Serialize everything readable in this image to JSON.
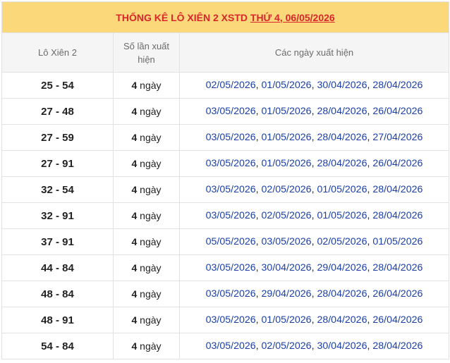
{
  "title": {
    "prefix": "THỐNG KÊ LÔ XIÊN 2 XSTD",
    "date_link": "THỨ 4, 06/05/2026"
  },
  "headers": {
    "pair": "Lô Xiên 2",
    "count": "Số lần xuất hiện",
    "dates": "Các ngày xuất hiện"
  },
  "count_unit": "ngày",
  "rows": [
    {
      "pair": "25 - 54",
      "count": "4",
      "dates": [
        "02/05/2026",
        "01/05/2026",
        "30/04/2026",
        "28/04/2026"
      ]
    },
    {
      "pair": "27 - 48",
      "count": "4",
      "dates": [
        "03/05/2026",
        "01/05/2026",
        "28/04/2026",
        "26/04/2026"
      ]
    },
    {
      "pair": "27 - 59",
      "count": "4",
      "dates": [
        "03/05/2026",
        "01/05/2026",
        "28/04/2026",
        "27/04/2026"
      ]
    },
    {
      "pair": "27 - 91",
      "count": "4",
      "dates": [
        "03/05/2026",
        "01/05/2026",
        "28/04/2026",
        "26/04/2026"
      ]
    },
    {
      "pair": "32 - 54",
      "count": "4",
      "dates": [
        "03/05/2026",
        "02/05/2026",
        "01/05/2026",
        "28/04/2026"
      ]
    },
    {
      "pair": "32 - 91",
      "count": "4",
      "dates": [
        "03/05/2026",
        "02/05/2026",
        "01/05/2026",
        "28/04/2026"
      ]
    },
    {
      "pair": "37 - 91",
      "count": "4",
      "dates": [
        "05/05/2026",
        "03/05/2026",
        "02/05/2026",
        "01/05/2026"
      ]
    },
    {
      "pair": "44 - 84",
      "count": "4",
      "dates": [
        "03/05/2026",
        "30/04/2026",
        "29/04/2026",
        "28/04/2026"
      ]
    },
    {
      "pair": "48 - 84",
      "count": "4",
      "dates": [
        "03/05/2026",
        "29/04/2026",
        "28/04/2026",
        "26/04/2026"
      ]
    },
    {
      "pair": "48 - 91",
      "count": "4",
      "dates": [
        "03/05/2026",
        "01/05/2026",
        "28/04/2026",
        "26/04/2026"
      ]
    },
    {
      "pair": "54 - 84",
      "count": "4",
      "dates": [
        "03/05/2026",
        "02/05/2026",
        "30/04/2026",
        "28/04/2026"
      ]
    }
  ],
  "colors": {
    "title_bg": "#fbd87a",
    "title_text": "#d8262c",
    "header_bg": "#f5f5f5",
    "date_link": "#1a3fa8",
    "border": "#e2e2e2"
  }
}
